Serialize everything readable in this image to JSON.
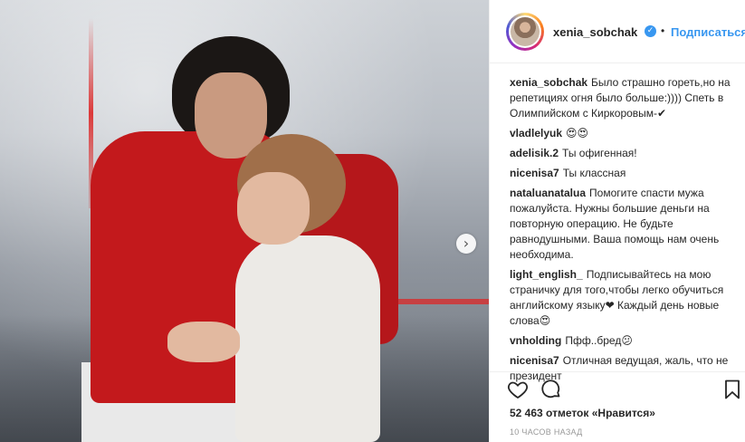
{
  "post": {
    "next_arrow": "›"
  },
  "header": {
    "username": "xenia_sobchak",
    "verified_mark": "✓",
    "separator": "•",
    "follow_label": "Подписаться"
  },
  "comments": [
    {
      "author": "xenia_sobchak",
      "text": "Было страшно гореть,но на репетициях огня было больше:)))) Спеть в Олимпийском с Киркоровым-✔"
    },
    {
      "author": "vladlelyuk",
      "text": "😍😍"
    },
    {
      "author": "adelisik.2",
      "text": "Ты офигенная!"
    },
    {
      "author": "nicenisa7",
      "text": "Ты классная"
    },
    {
      "author": "nataluanatalua",
      "text": "Помогите спасти мужа пожалуйста. Нужны большие деньги на повторную операцию. Не будьте равнодушными. Ваша помощь нам очень необходима."
    },
    {
      "author": "light_english_",
      "text": "Подписывайтесь на мою страничку для того,чтобы легко обучиться английскому языку❤ Каждый день новые слова😍"
    },
    {
      "author": "vnholding",
      "text": "Пфф..бред😕"
    },
    {
      "author": "nicenisa7",
      "text": "Отличная ведущая, жаль, что не президент"
    }
  ],
  "footer": {
    "likes": "52 463 отметок «Нравится»",
    "time": "10 ЧАСОВ НАЗАД"
  },
  "icons": {
    "heart": "heart-icon",
    "comment": "comment-icon",
    "bookmark": "bookmark-icon",
    "verified": "verified-badge-icon",
    "next": "chevron-right-icon"
  },
  "colors": {
    "link_blue": "#3897f0",
    "text": "#262626",
    "muted": "#999999"
  }
}
